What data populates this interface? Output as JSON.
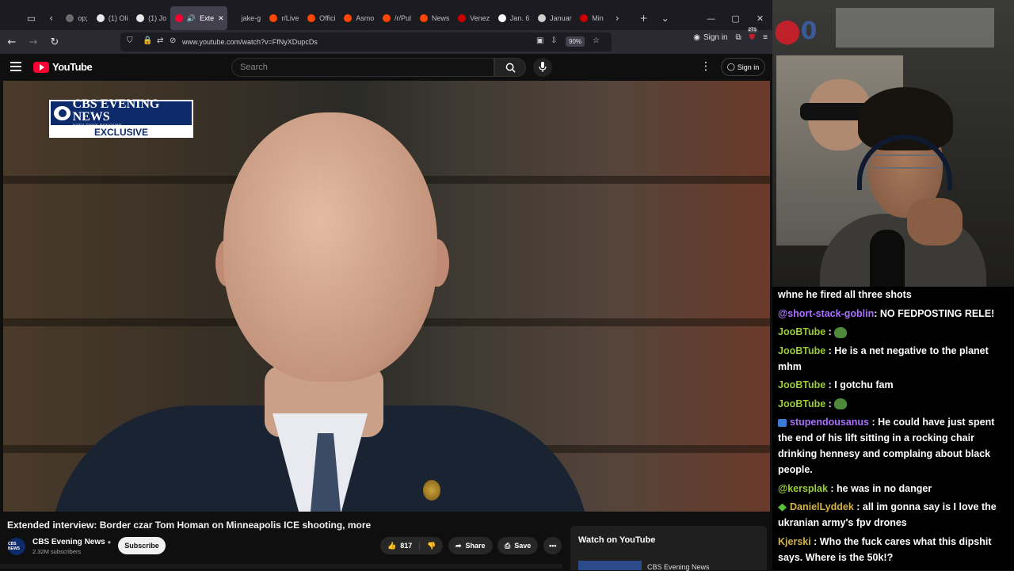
{
  "browser": {
    "tabs": [
      {
        "label": "op;",
        "color": "#6b6b6b"
      },
      {
        "label": "(1) Oli",
        "color": "#e8e8e8"
      },
      {
        "label": "(1) Jo",
        "color": "#e8e8e8"
      },
      {
        "label": "Exte",
        "color": "#ff0033",
        "active": true
      },
      {
        "label": "jake-g",
        "color": "#1c1b22"
      },
      {
        "label": "r/Live",
        "color": "#ff4500"
      },
      {
        "label": "Offici",
        "color": "#ff4500"
      },
      {
        "label": "Asmo",
        "color": "#ff4500"
      },
      {
        "label": "/r/Pul",
        "color": "#ff4500"
      },
      {
        "label": "News",
        "color": "#ff4500"
      },
      {
        "label": "Venez",
        "color": "#cc0000"
      },
      {
        "label": "Jan. 6",
        "color": "#ffffff"
      },
      {
        "label": "Januar",
        "color": "#cfcfcf"
      },
      {
        "label": "Min",
        "color": "#cc0000"
      }
    ],
    "url": "www.youtube.com/watch?v=FfNyXDupcDs",
    "zoom": "90%",
    "signin_label": "Sign in",
    "ext_badge": "271"
  },
  "youtube": {
    "logo_text": "YouTube",
    "search_placeholder": "Search",
    "signin_label": "Sign in",
    "video": {
      "badge_name": "CBS EVENING NEWS",
      "badge_sub": "WITH TONY DOKOUPIL",
      "badge_exclusive": "EXCLUSIVE",
      "title": "Extended interview: Border czar Tom Homan on Minneapolis ICE shooting, more",
      "channel": "CBS Evening News",
      "channel_avatar": "CBS NEWS",
      "subscribers": "2.32M subscribers",
      "subscribe_label": "Subscribe",
      "likes": "817",
      "share_label": "Share",
      "save_label": "Save"
    },
    "watch_on_youtube": "Watch on YouTube",
    "related_channel": "CBS Evening News"
  },
  "stream": {
    "overlay_logo": "0",
    "chat": [
      {
        "user": "",
        "text": "whne he fired all three shots",
        "color": "#ffffff"
      },
      {
        "user": "@short-stack-goblin",
        "text": ": NO FEDPOSTING RELE!",
        "color": "#a970ff"
      },
      {
        "user": "JooBTube",
        "text": " : ",
        "color": "#9acd32",
        "emote": true
      },
      {
        "user": "JooBTube",
        "text": " : He is a net negative to the planet mhm",
        "color": "#9acd32"
      },
      {
        "user": "JooBTube",
        "text": " : I gotchu fam",
        "color": "#9acd32"
      },
      {
        "user": "JooBTube",
        "text": " : ",
        "color": "#9acd32",
        "emote": true
      },
      {
        "user": "stupendousanus",
        "text": " : He could have just spent the end of his lift sitting in a rocking chair drinking hennesy and complaing about black people.",
        "color": "#a970ff",
        "badge": "#3a7bd5"
      },
      {
        "user": "@kersplak",
        "text": " : he was in no danger",
        "color": "#9acd32"
      },
      {
        "user": "DanielLyddek",
        "text": " : all im gonna say is I love the ukranian army's fpv drones",
        "color": "#d4b44a",
        "badge": "#58c23a"
      },
      {
        "user": "Kjerski",
        "text": " : Who the fuck cares what this dipshit says. Where is the 50k!?",
        "color": "#d4b44a"
      }
    ]
  }
}
